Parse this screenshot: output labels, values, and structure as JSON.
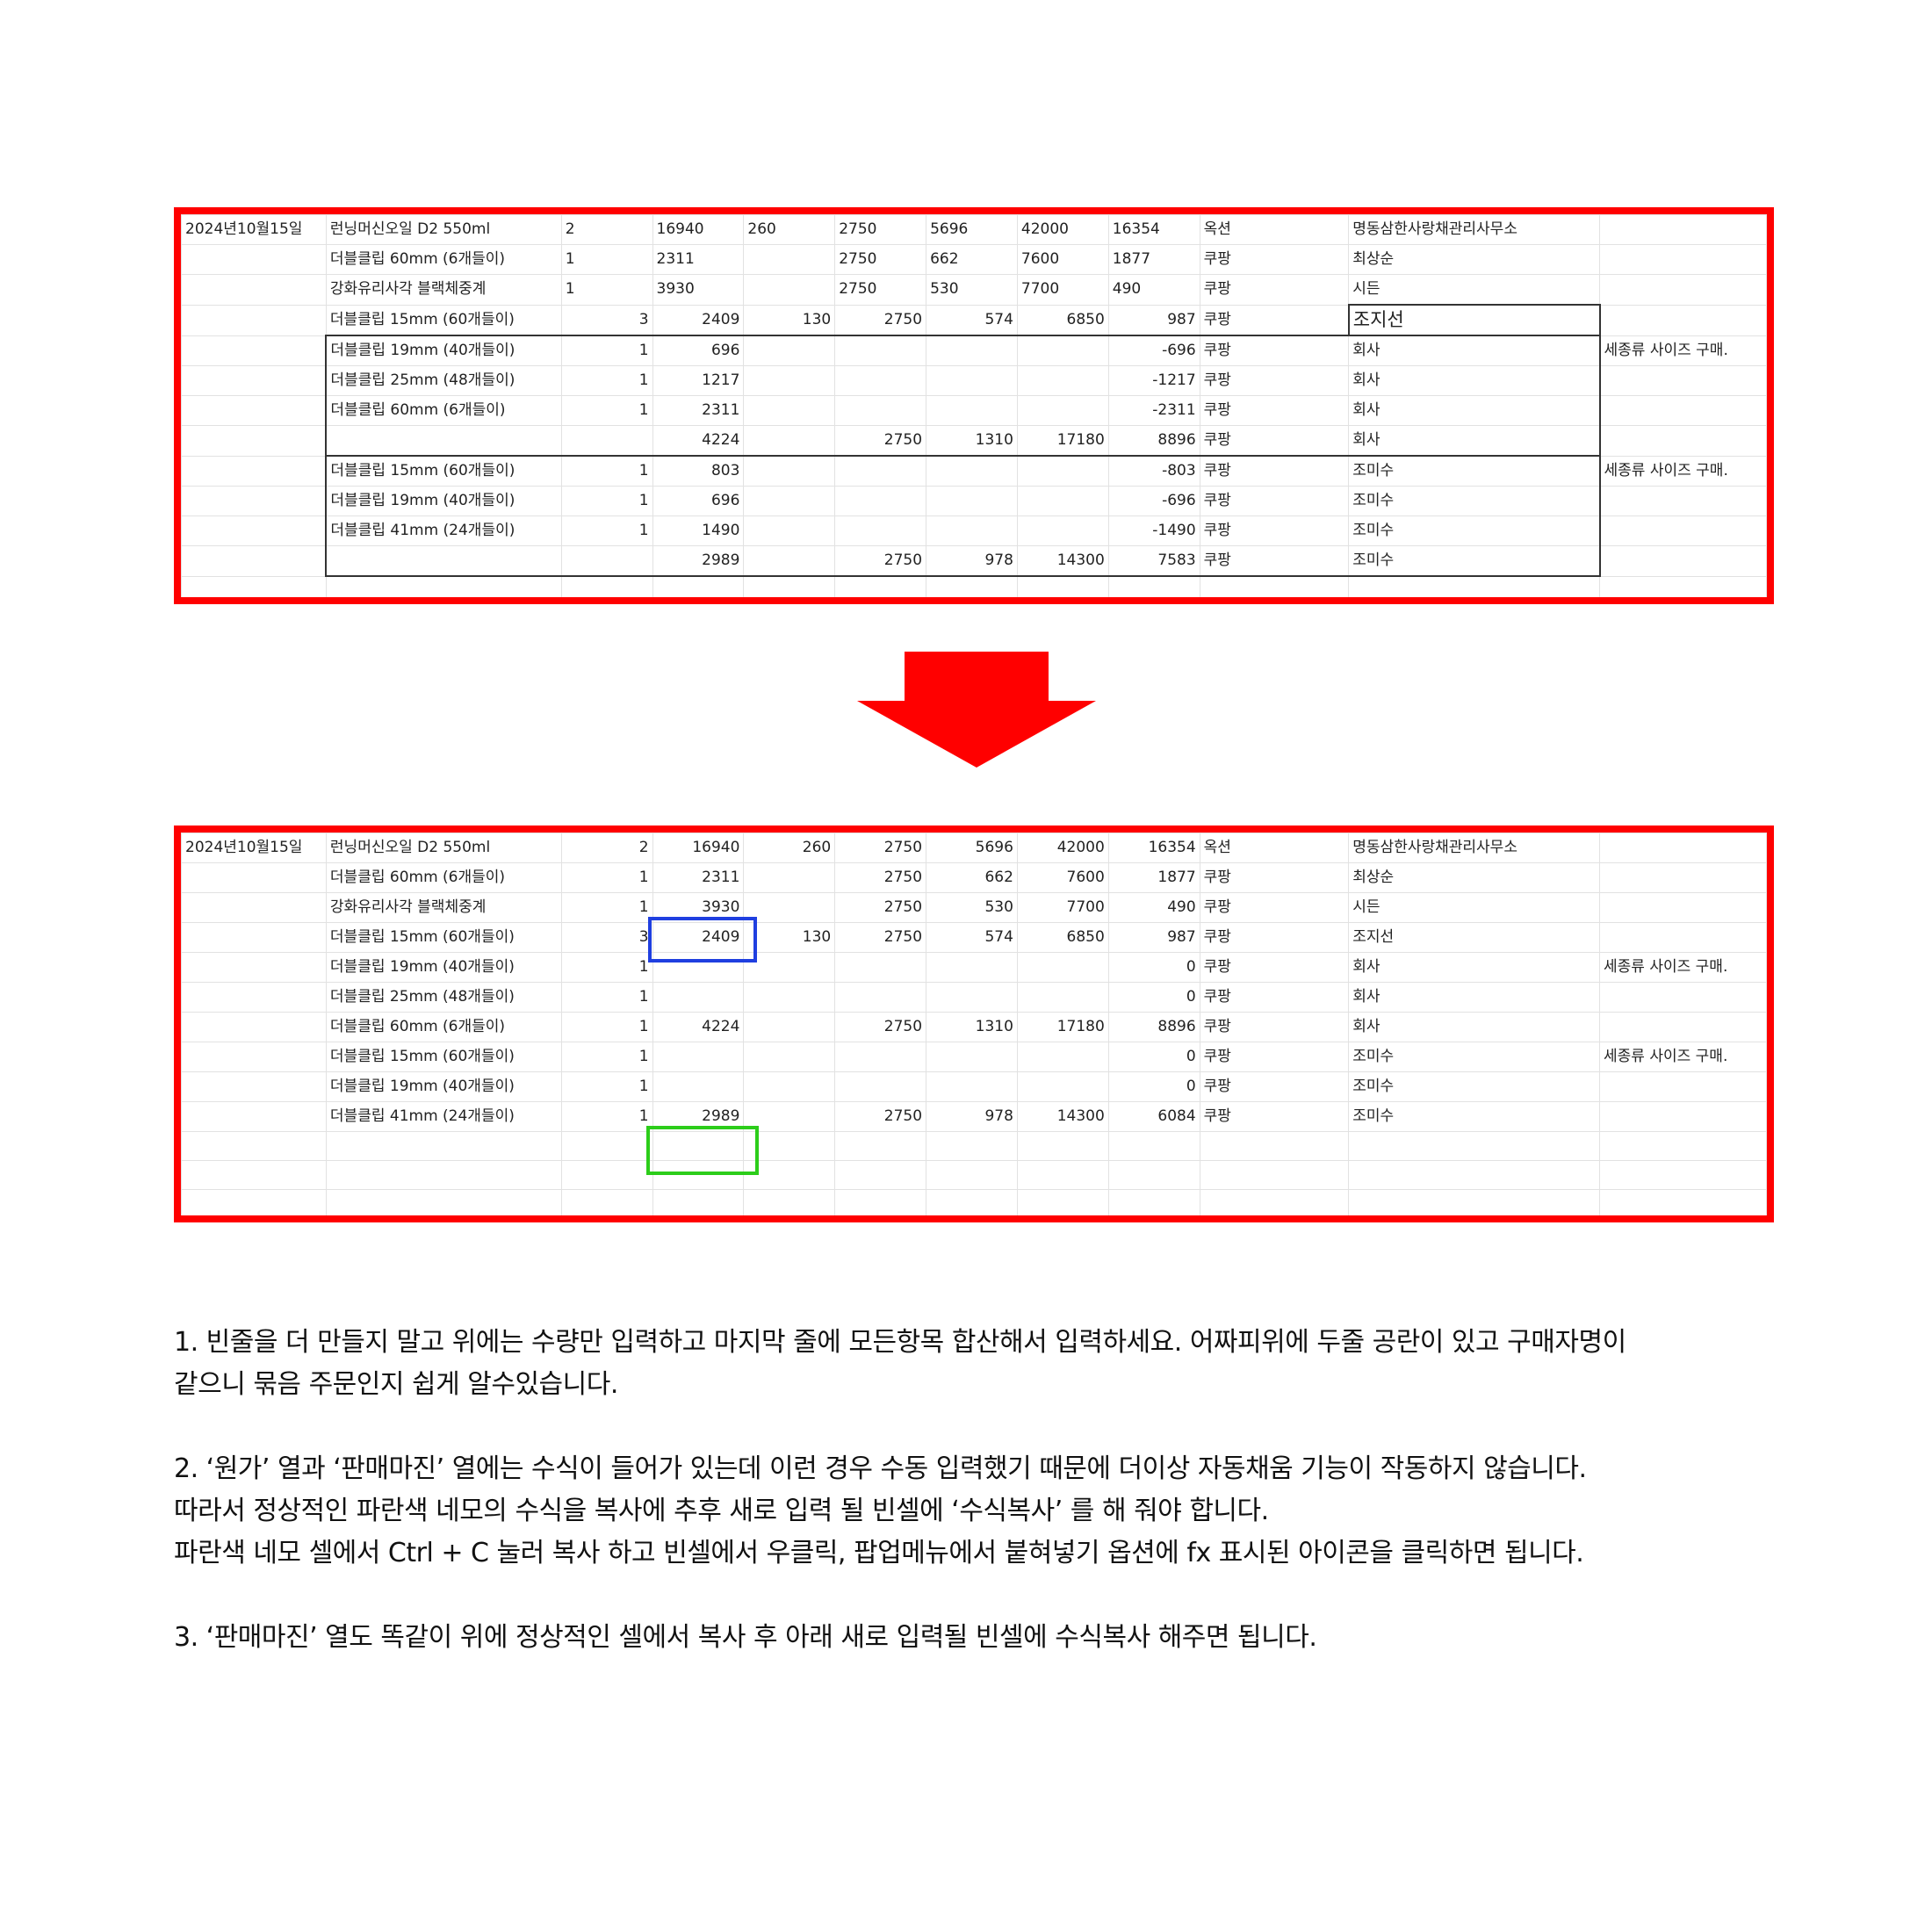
{
  "colors": {
    "frame": "#ff0000",
    "blue_box": "#1f3fe0",
    "green_box": "#2ccd1a",
    "arrow": "#ff0000"
  },
  "arrow_icon": "arrow-down-icon",
  "top_sheet": {
    "rows": [
      [
        "2024년10월15일",
        "런닝머신오일 D2 550ml",
        "2",
        "16940",
        "260",
        "2750",
        "5696",
        "42000",
        "16354",
        "옥션",
        "명동삼한사랑채관리사무소",
        ""
      ],
      [
        "",
        "더블클립 60mm (6개들이)",
        "1",
        "2311",
        "",
        "2750",
        "662",
        "7600",
        "1877",
        "쿠팡",
        "최상순",
        ""
      ],
      [
        "",
        "강화유리사각 블랙체중계",
        "1",
        "3930",
        "",
        "2750",
        "530",
        "7700",
        "490",
        "쿠팡",
        "시든",
        ""
      ],
      [
        "",
        "더블클립 15mm (60개들이)",
        "3",
        "2409",
        "130",
        "2750",
        "574",
        "6850",
        "987",
        "쿠팡",
        "조지선",
        ""
      ],
      [
        "",
        "더블클립 19mm (40개들이)",
        "1",
        "696",
        "",
        "",
        "",
        "",
        "-696",
        "쿠팡",
        "회사",
        "세종류 사이즈 구매."
      ],
      [
        "",
        "더블클립 25mm (48개들이)",
        "1",
        "1217",
        "",
        "",
        "",
        "",
        "-1217",
        "쿠팡",
        "회사",
        ""
      ],
      [
        "",
        "더블클립 60mm (6개들이)",
        "1",
        "2311",
        "",
        "",
        "",
        "",
        "-2311",
        "쿠팡",
        "회사",
        ""
      ],
      [
        "",
        "",
        "",
        "4224",
        "",
        "2750",
        "1310",
        "17180",
        "8896",
        "쿠팡",
        "회사",
        ""
      ],
      [
        "",
        "더블클립 15mm (60개들이)",
        "1",
        "803",
        "",
        "",
        "",
        "",
        "-803",
        "쿠팡",
        "조미수",
        "세종류 사이즈 구매."
      ],
      [
        "",
        "더블클립 19mm (40개들이)",
        "1",
        "696",
        "",
        "",
        "",
        "",
        "-696",
        "쿠팡",
        "조미수",
        ""
      ],
      [
        "",
        "더블클립 41mm (24개들이)",
        "1",
        "1490",
        "",
        "",
        "",
        "",
        "-1490",
        "쿠팡",
        "조미수",
        ""
      ],
      [
        "",
        "",
        "",
        "2989",
        "",
        "2750",
        "978",
        "14300",
        "7583",
        "쿠팡",
        "조미수",
        ""
      ],
      [
        "",
        "",
        "",
        "",
        "",
        "",
        "",
        "",
        "",
        "",
        "",
        ""
      ]
    ]
  },
  "bottom_sheet": {
    "rows": [
      [
        "2024년10월15일",
        "런닝머신오일 D2 550ml",
        "2",
        "16940",
        "260",
        "2750",
        "5696",
        "42000",
        "16354",
        "옥션",
        "명동삼한사랑채관리사무소",
        ""
      ],
      [
        "",
        "더블클립 60mm (6개들이)",
        "1",
        "2311",
        "",
        "2750",
        "662",
        "7600",
        "1877",
        "쿠팡",
        "최상순",
        ""
      ],
      [
        "",
        "강화유리사각 블랙체중계",
        "1",
        "3930",
        "",
        "2750",
        "530",
        "7700",
        "490",
        "쿠팡",
        "시든",
        ""
      ],
      [
        "",
        "더블클립 15mm (60개들이)",
        "3",
        "2409",
        "130",
        "2750",
        "574",
        "6850",
        "987",
        "쿠팡",
        "조지선",
        ""
      ],
      [
        "",
        "더블클립 19mm (40개들이)",
        "1",
        "",
        "",
        "",
        "",
        "",
        "0",
        "쿠팡",
        "회사",
        "세종류 사이즈 구매."
      ],
      [
        "",
        "더블클립 25mm (48개들이)",
        "1",
        "",
        "",
        "",
        "",
        "",
        "0",
        "쿠팡",
        "회사",
        ""
      ],
      [
        "",
        "더블클립 60mm (6개들이)",
        "1",
        "4224",
        "",
        "2750",
        "1310",
        "17180",
        "8896",
        "쿠팡",
        "회사",
        ""
      ],
      [
        "",
        "더블클립 15mm (60개들이)",
        "1",
        "",
        "",
        "",
        "",
        "",
        "0",
        "쿠팡",
        "조미수",
        "세종류 사이즈 구매."
      ],
      [
        "",
        "더블클립 19mm (40개들이)",
        "1",
        "",
        "",
        "",
        "",
        "",
        "0",
        "쿠팡",
        "조미수",
        ""
      ],
      [
        "",
        "더블클립 41mm (24개들이)",
        "1",
        "2989",
        "",
        "2750",
        "978",
        "14300",
        "6084",
        "쿠팡",
        "조미수",
        ""
      ],
      [
        "",
        "",
        "",
        "",
        "",
        "",
        "",
        "",
        "",
        "",
        "",
        ""
      ],
      [
        "",
        "",
        "",
        "",
        "",
        "",
        "",
        "",
        "",
        "",
        "",
        ""
      ],
      [
        "",
        "",
        "",
        "",
        "",
        "",
        "",
        "",
        "",
        "",
        "",
        ""
      ]
    ]
  },
  "notes": {
    "n1_line1": "1. 빈줄을 더 만들지 말고 위에는 수량만 입력하고 마지막 줄에 모든항목 합산해서 입력하세요. 어짜피위에 두줄 공란이 있고 구매자명이",
    "n1_line2": "같으니 묶음 주문인지 쉽게 알수있습니다.",
    "n2_line1": "2. ‘원가’ 열과 ‘판매마진’ 열에는 수식이 들어가 있는데 이런 경우 수동 입력했기 때문에 더이상 자동채움 기능이 작동하지 않습니다.",
    "n2_line2": "따라서 정상적인 파란색 네모의 수식을 복사에 추후 새로 입력 될 빈셀에 ‘수식복사’ 를 해 줘야 합니다.",
    "n2_line3": "파란색 네모 셀에서 Ctrl + C 눌러 복사 하고 빈셀에서 우클릭, 팝업메뉴에서   붙혀넣기 옵션에 fx 표시된 아이콘을 클릭하면 됩니다.",
    "n3_line1": "3. ‘판매마진’ 열도 똑같이 위에 정상적인 셀에서 복사 후 아래 새로 입력될 빈셀에 수식복사 해주면 됩니다."
  }
}
